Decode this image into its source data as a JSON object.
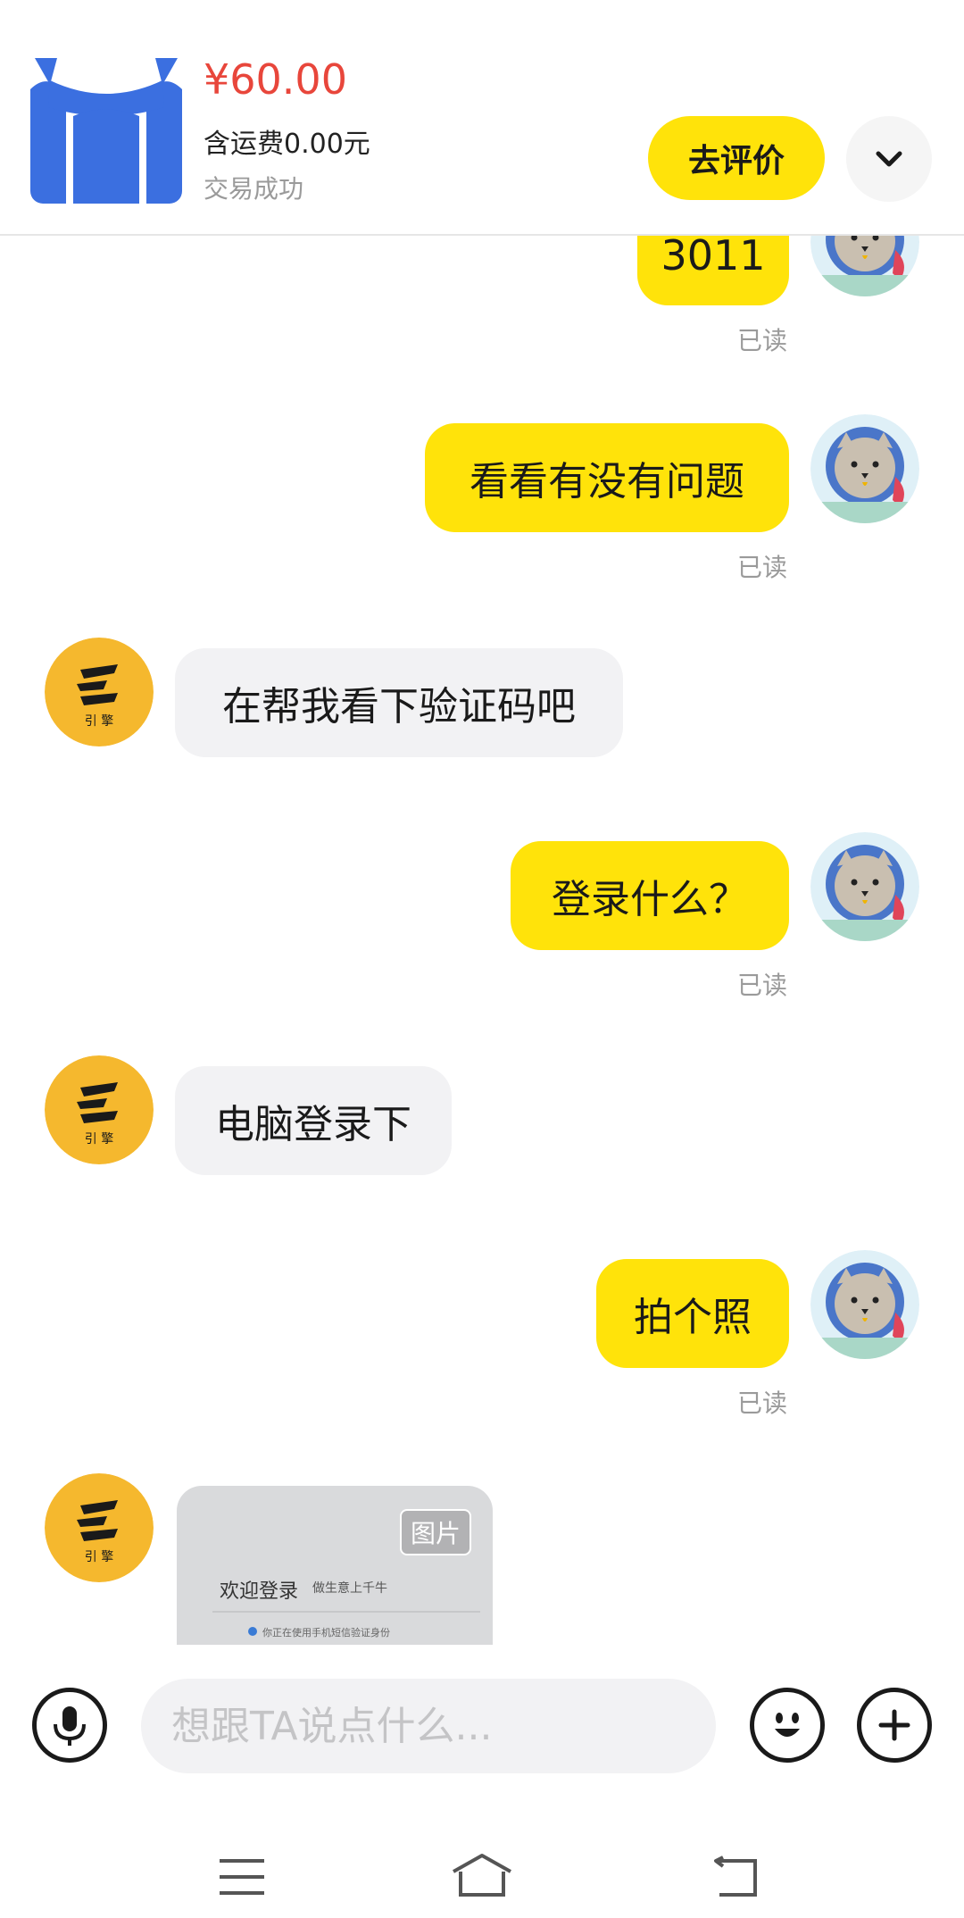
{
  "order": {
    "price": "¥60.00",
    "shipping": "含运费0.00元",
    "status": "交易成功",
    "review_label": "去评价"
  },
  "chat": {
    "messages": [
      {
        "side": "out",
        "text": "3011",
        "status": "已读"
      },
      {
        "side": "out",
        "text": "看看有没有问题",
        "status": "已读"
      },
      {
        "side": "in",
        "text": "在帮我看下验证码吧"
      },
      {
        "side": "out",
        "text": "登录什么？",
        "status": "已读"
      },
      {
        "side": "in",
        "text": "电脑登录下"
      },
      {
        "side": "out",
        "text": "拍个照",
        "status": "已读"
      },
      {
        "side": "in",
        "type": "image",
        "tag": "图片",
        "image_title": "欢迎登录",
        "image_subtitle": "做生意上千牛",
        "image_tip": "你正在使用手机短信验证身份"
      }
    ],
    "seller_avatar_text": "引 擎"
  },
  "input": {
    "placeholder": "想跟TA说点什么..."
  },
  "icons": {
    "voice": "microphone-icon",
    "emoji": "emoji-icon",
    "plus": "plus-icon",
    "expand": "chevron-down-icon",
    "nav_menu": "menu-icon",
    "nav_home": "home-icon",
    "nav_back": "back-icon"
  },
  "colors": {
    "accent": "#ffe30a",
    "price": "#e8463b",
    "incoming_bubble": "#f2f2f4",
    "muted_text": "#9a9a9a"
  }
}
